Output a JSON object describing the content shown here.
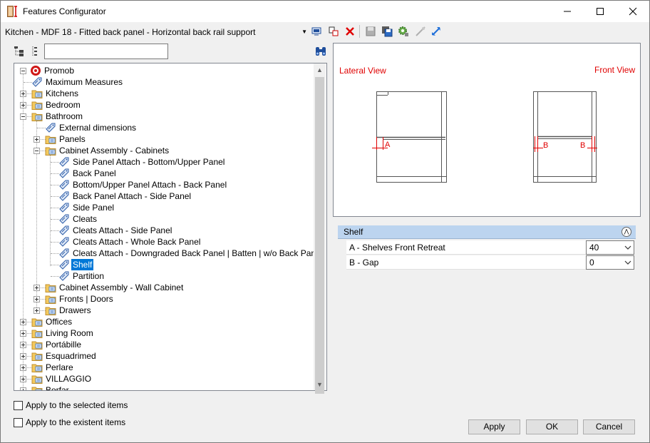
{
  "window": {
    "title": "Features Configurator"
  },
  "toolbar": {
    "config_value": "Kitchen - MDF 18 - Fitted back panel - Horizontal back rail support",
    "icons": [
      "monitor-icon",
      "copy-icon",
      "delete-icon",
      "save-icon",
      "save-as-icon",
      "gear-icon",
      "collapse-link-icon",
      "expand-link-icon"
    ]
  },
  "tree": {
    "search_value": "",
    "root": "Promob",
    "items": [
      {
        "label": "Maximum Measures",
        "level": 1,
        "type": "feature"
      },
      {
        "label": "Kitchens",
        "level": 1,
        "type": "folder",
        "expanded": false
      },
      {
        "label": "Bedroom",
        "level": 1,
        "type": "folder",
        "expanded": false
      },
      {
        "label": "Bathroom",
        "level": 1,
        "type": "folder",
        "expanded": true
      },
      {
        "label": "External dimensions",
        "level": 2,
        "type": "feature"
      },
      {
        "label": "Panels",
        "level": 2,
        "type": "folder",
        "expanded": false
      },
      {
        "label": "Cabinet Assembly - Cabinets",
        "level": 2,
        "type": "folder",
        "expanded": true
      },
      {
        "label": "Side Panel Attach - Bottom/Upper Panel",
        "level": 3,
        "type": "feature"
      },
      {
        "label": "Back Panel",
        "level": 3,
        "type": "feature"
      },
      {
        "label": " Bottom/Upper Panel Attach - Back Panel",
        "level": 3,
        "type": "feature"
      },
      {
        "label": "Back Panel Attach - Side Panel",
        "level": 3,
        "type": "feature"
      },
      {
        "label": "Side Panel",
        "level": 3,
        "type": "feature"
      },
      {
        "label": "Cleats",
        "level": 3,
        "type": "feature"
      },
      {
        "label": "Cleats Attach - Side Panel",
        "level": 3,
        "type": "feature"
      },
      {
        "label": "Cleats Attach - Whole Back Panel",
        "level": 3,
        "type": "feature"
      },
      {
        "label": "Cleats Attach - Downgraded Back Panel | Batten | w/o Back Panel",
        "level": 3,
        "type": "feature"
      },
      {
        "label": "Shelf",
        "level": 3,
        "type": "feature",
        "selected": true
      },
      {
        "label": "Partition",
        "level": 3,
        "type": "feature"
      },
      {
        "label": "Cabinet Assembly - Wall Cabinet",
        "level": 2,
        "type": "folder",
        "expanded": false
      },
      {
        "label": "Fronts | Doors",
        "level": 2,
        "type": "folder",
        "expanded": false
      },
      {
        "label": "Drawers",
        "level": 2,
        "type": "folder",
        "expanded": false
      },
      {
        "label": "Offices",
        "level": 1,
        "type": "folder",
        "expanded": false
      },
      {
        "label": "Living Room",
        "level": 1,
        "type": "folder",
        "expanded": false
      },
      {
        "label": "Portábille",
        "level": 1,
        "type": "folder",
        "expanded": false
      },
      {
        "label": "Esquadrimed",
        "level": 1,
        "type": "folder",
        "expanded": false
      },
      {
        "label": "Perlare",
        "level": 1,
        "type": "folder",
        "expanded": false
      },
      {
        "label": "VILLAGGIO",
        "level": 1,
        "type": "folder",
        "expanded": false
      },
      {
        "label": "Borfar",
        "level": 1,
        "type": "folder",
        "expanded": false
      }
    ]
  },
  "checkboxes": {
    "apply_selected": "Apply to the selected items",
    "apply_existent": "Apply to the existent items"
  },
  "preview": {
    "lateral_label": "Lateral View",
    "front_label": "Front View",
    "dim_a": "A",
    "dim_b1": "B",
    "dim_b2": "B",
    "accent": "#e00000"
  },
  "properties": {
    "group": "Shelf",
    "rows": [
      {
        "name": "A - Shelves Front Retreat",
        "value": "40"
      },
      {
        "name": "B - Gap",
        "value": "0"
      }
    ]
  },
  "buttons": {
    "apply": "Apply",
    "ok": "OK",
    "cancel": "Cancel"
  }
}
